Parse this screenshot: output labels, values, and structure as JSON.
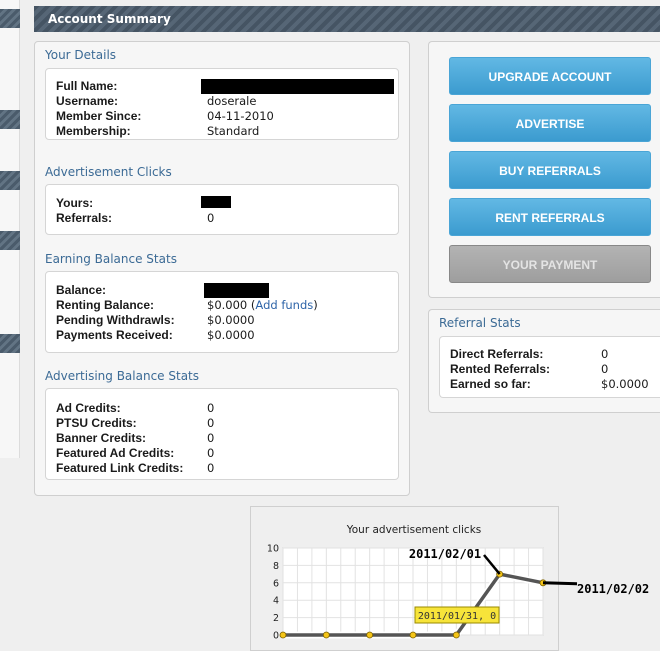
{
  "header": {
    "title": "Account Summary"
  },
  "details": {
    "title": "Your Details",
    "rows": [
      {
        "label": "Full Name:",
        "value": ""
      },
      {
        "label": "Username:",
        "value": "doserale"
      },
      {
        "label": "Member Since:",
        "value": "04-11-2010"
      },
      {
        "label": "Membership:",
        "value": "Standard"
      }
    ]
  },
  "ad_clicks": {
    "title": "Advertisement Clicks",
    "rows": [
      {
        "label": "Yours:",
        "value": ""
      },
      {
        "label": "Referrals:",
        "value": "0"
      }
    ]
  },
  "earning": {
    "title": "Earning Balance Stats",
    "rows": [
      {
        "label": "Balance:",
        "value": ""
      },
      {
        "label": "Renting Balance:",
        "value": "$0.000",
        "link_open": "(",
        "link": "Add funds",
        "link_close": ")"
      },
      {
        "label": "Pending Withdrawls:",
        "value": "$0.0000"
      },
      {
        "label": "Payments Received:",
        "value": "$0.0000"
      }
    ]
  },
  "advertising": {
    "title": "Advertising Balance Stats",
    "rows": [
      {
        "label": "Ad Credits:",
        "value": "0"
      },
      {
        "label": "PTSU Credits:",
        "value": "0"
      },
      {
        "label": "Banner Credits:",
        "value": "0"
      },
      {
        "label": "Featured Ad Credits:",
        "value": "0"
      },
      {
        "label": "Featured Link Credits:",
        "value": "0"
      }
    ]
  },
  "buttons": {
    "upgrade": "UPGRADE ACCOUNT",
    "advertise": "ADVERTISE",
    "buy_referrals": "BUY REFERRALS",
    "rent_referrals": "RENT REFERRALS",
    "your_payment": "YOUR PAYMENT"
  },
  "referral": {
    "title": "Referral Stats",
    "rows": [
      {
        "label": "Direct Referrals:",
        "value": "0"
      },
      {
        "label": "Rented Referrals:",
        "value": "0"
      },
      {
        "label": "Earned so far:",
        "value": "$0.0000"
      }
    ]
  },
  "colors": {
    "accent": "#3b6a95",
    "button_blue": "#4aa5d6",
    "button_grey": "#9e9e9e",
    "point": "#f5c518",
    "tooltip": "#f7e43a"
  },
  "chart_data": {
    "type": "line",
    "title": "Your advertisement clicks",
    "yticks": [
      0,
      2,
      4,
      6,
      8,
      10
    ],
    "ylim": [
      0,
      10
    ],
    "grid": true,
    "x": [
      "",
      "",
      "",
      "",
      "2011/01/31",
      "2011/02/01",
      "2011/02/02"
    ],
    "values": [
      0,
      0,
      0,
      0,
      0,
      7,
      6
    ],
    "annotations": {
      "top": "2011/02/01",
      "right": "2011/02/02",
      "tooltip": "2011/01/31, 0"
    }
  }
}
